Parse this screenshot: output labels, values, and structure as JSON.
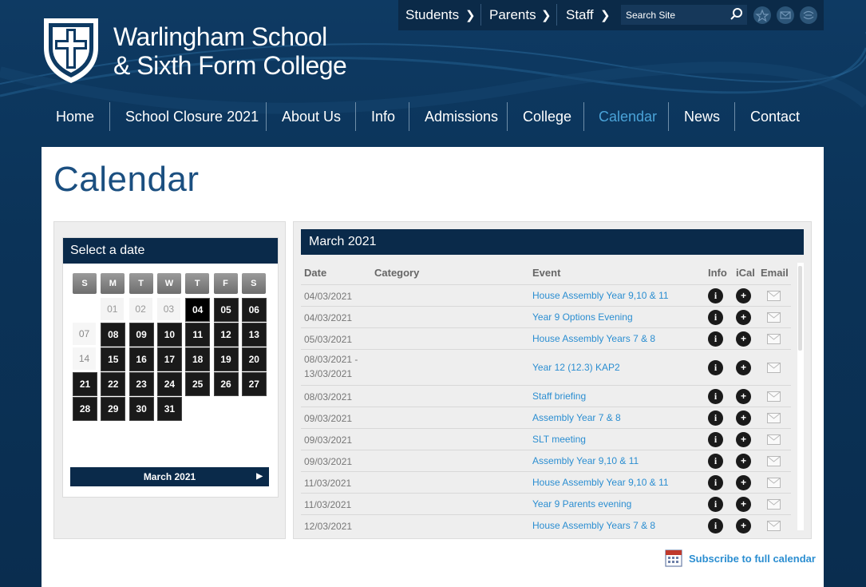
{
  "util_nav": {
    "links": [
      "Students",
      "Parents",
      "Staff"
    ],
    "search_placeholder": "Search Site"
  },
  "school": {
    "line1": "Warlingham School",
    "line2": "& Sixth Form College"
  },
  "main_nav": {
    "items": [
      "Home",
      "School Closure 2021",
      "About Us",
      "Info",
      "Admissions",
      "College",
      "Calendar",
      "News",
      "Contact"
    ],
    "active": "Calendar"
  },
  "page": {
    "title": "Calendar"
  },
  "date_picker": {
    "heading": "Select a date",
    "day_headers": [
      "S",
      "M",
      "T",
      "W",
      "T",
      "F",
      "S"
    ],
    "month_label": "March 2021",
    "rows": [
      [
        "",
        "01",
        "02",
        "03",
        "04",
        "05",
        "06"
      ],
      [
        "07",
        "08",
        "09",
        "10",
        "11",
        "12",
        "13"
      ],
      [
        "14",
        "15",
        "16",
        "17",
        "18",
        "19",
        "20"
      ],
      [
        "21",
        "22",
        "23",
        "24",
        "25",
        "26",
        "27"
      ],
      [
        "28",
        "29",
        "30",
        "31",
        "",
        "",
        ""
      ]
    ],
    "today": "04"
  },
  "events": {
    "heading": "March 2021",
    "columns": [
      "Date",
      "Category",
      "Event",
      "Info",
      "iCal",
      "Email"
    ],
    "rows": [
      {
        "date": "04/03/2021",
        "event": "House Assembly Year 9,10 & 11"
      },
      {
        "date": "04/03/2021",
        "event": "Year 9 Options Evening"
      },
      {
        "date": "05/03/2021",
        "event": "House Assembly Years 7 & 8"
      },
      {
        "date": "08/03/2021 -",
        "date2": "13/03/2021",
        "event": "Year 12 (12.3) KAP2"
      },
      {
        "date": "08/03/2021",
        "event": "Staff briefing"
      },
      {
        "date": "09/03/2021",
        "event": "Assembly Year 7 & 8"
      },
      {
        "date": "09/03/2021",
        "event": "SLT meeting"
      },
      {
        "date": "09/03/2021",
        "event": "Assembly Year 9,10 & 11"
      },
      {
        "date": "11/03/2021",
        "event": "House Assembly Year 9,10 & 11"
      },
      {
        "date": "11/03/2021",
        "event": "Year 9 Parents evening"
      },
      {
        "date": "12/03/2021",
        "event": "House Assembly Years 7 & 8"
      }
    ],
    "subscribe_label": "Subscribe to full calendar"
  }
}
